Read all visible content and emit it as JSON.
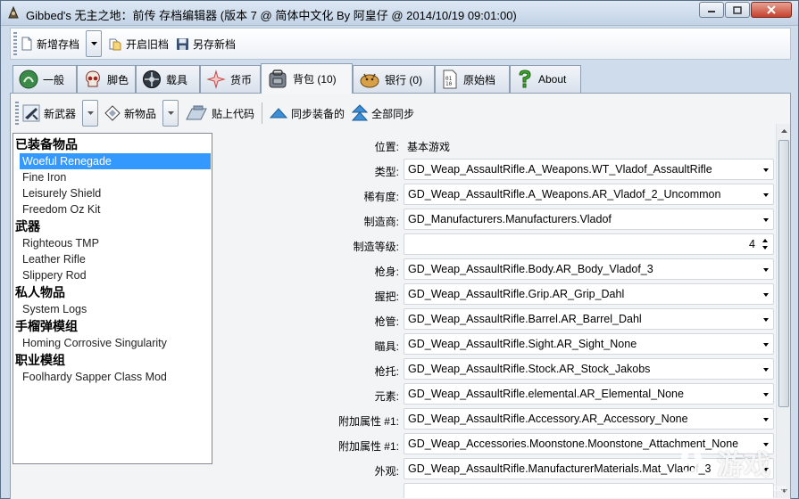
{
  "window": {
    "title": "Gibbed's 无主之地：前传 存档编辑器 (版本 7 @ 简体中文化 By 阿皇仔 @  2014/10/19 09:01:00)"
  },
  "toolbar": {
    "new_save": "新增存档",
    "open_old": "开启旧档",
    "save_new": "另存新档"
  },
  "tabs": [
    {
      "label": "一般",
      "icon": "general-icon"
    },
    {
      "label": "脚色",
      "icon": "skull-icon"
    },
    {
      "label": "载具",
      "icon": "vehicle-icon"
    },
    {
      "label": "货币",
      "icon": "currency-icon"
    },
    {
      "label": "背包 (10)",
      "icon": "backpack-icon"
    },
    {
      "label": "银行 (0)",
      "icon": "bank-icon"
    },
    {
      "label": "原始档",
      "icon": "raw-file-icon"
    },
    {
      "label": "About",
      "icon": "question-icon"
    }
  ],
  "inventory_toolbar": {
    "new_weapon": "新武器",
    "new_item": "新物品",
    "paste_code": "贴上代码",
    "sync_equipped": "同步装备的",
    "sync_all": "全部同步"
  },
  "tree": {
    "categories": [
      {
        "name": "已装备物品",
        "items": [
          "Woeful Renegade",
          "Fine Iron",
          "Leisurely Shield",
          "Freedom Oz Kit"
        ]
      },
      {
        "name": "武器",
        "items": [
          "Righteous TMP",
          "Leather Rifle",
          "Slippery Rod"
        ]
      },
      {
        "name": "私人物品",
        "items": [
          "System Logs"
        ]
      },
      {
        "name": "手榴弹模组",
        "items": [
          "Homing Corrosive Singularity"
        ]
      },
      {
        "name": "职业模组",
        "items": [
          "Foolhardy Sapper Class Mod"
        ]
      }
    ],
    "selected": "Woeful Renegade"
  },
  "properties": {
    "location_label": "位置:",
    "location_value": "基本游戏",
    "type_label": "类型:",
    "type_value": "GD_Weap_AssaultRifle.A_Weapons.WT_Vladof_AssaultRifle",
    "rarity_label": "稀有度:",
    "rarity_value": "GD_Weap_AssaultRifle.A_Weapons.AR_Vladof_2_Uncommon",
    "manufacturer_label": "制造商:",
    "manufacturer_value": "GD_Manufacturers.Manufacturers.Vladof",
    "level_label": "制造等级:",
    "level_value": "4",
    "body_label": "枪身:",
    "body_value": "GD_Weap_AssaultRifle.Body.AR_Body_Vladof_3",
    "grip_label": "握把:",
    "grip_value": "GD_Weap_AssaultRifle.Grip.AR_Grip_Dahl",
    "barrel_label": "枪管:",
    "barrel_value": "GD_Weap_AssaultRifle.Barrel.AR_Barrel_Dahl",
    "sight_label": "瞄具:",
    "sight_value": "GD_Weap_AssaultRifle.Sight.AR_Sight_None",
    "stock_label": "枪托:",
    "stock_value": "GD_Weap_AssaultRifle.Stock.AR_Stock_Jakobs",
    "element_label": "元素:",
    "element_value": "GD_Weap_AssaultRifle.elemental.AR_Elemental_None",
    "acc1_label": "附加属性 #1:",
    "acc1_value": "GD_Weap_AssaultRifle.Accessory.AR_Accessory_None",
    "acc2_label": "附加属性 #1:",
    "acc2_value": "GD_Weap_Accessories.Moonstone.Moonstone_Attachment_None",
    "material_label": "外观:",
    "material_value": "GD_Weap_AssaultRifle.ManufacturerMaterials.Mat_Vladof_3"
  },
  "watermark": {
    "text": "游戏",
    "url": "91danji.com"
  },
  "colors": {
    "selection": "#3399ff",
    "window_bg": "#cfdceb",
    "panel_bg": "#f3f4f6"
  }
}
